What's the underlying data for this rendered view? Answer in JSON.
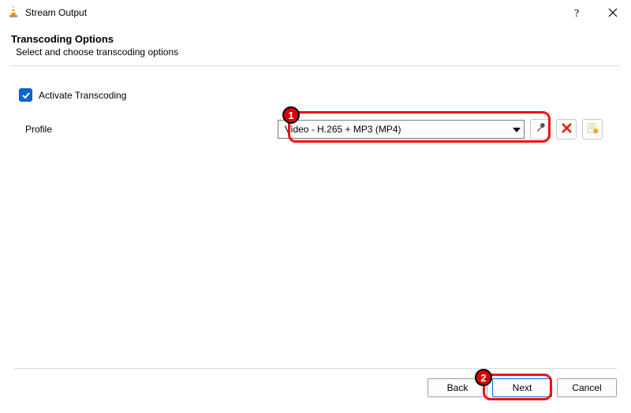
{
  "titlebar": {
    "title": "Stream Output"
  },
  "section": {
    "heading": "Transcoding Options",
    "subheading": "Select and choose transcoding options"
  },
  "activate": {
    "label": "Activate Transcoding",
    "checked": true
  },
  "profile": {
    "label": "Profile",
    "selected": "Video - H.265 + MP3 (MP4)"
  },
  "icons": {
    "edit": "wrench-icon",
    "delete": "x-icon",
    "new": "new-profile-icon"
  },
  "footer": {
    "back": "Back",
    "next": "Next",
    "cancel": "Cancel"
  },
  "annotations": {
    "badge1": "1",
    "badge2": "2"
  }
}
